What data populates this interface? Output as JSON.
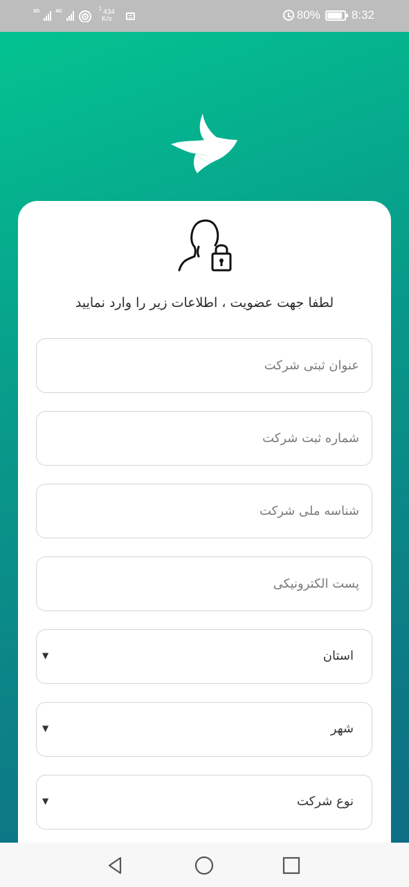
{
  "status_bar": {
    "net_type_1": "3G",
    "net_type_2": "4G",
    "speed_sup": "1",
    "speed_value": "434",
    "speed_unit": "K/s",
    "battery": "80%",
    "time": "8:32",
    "icons": [
      "signal-icon",
      "wifi-icon",
      "message-icon",
      "alarm-icon",
      "battery-icon"
    ]
  },
  "app": {
    "logo_icon": "bird-logo-icon",
    "form_icon": "user-lock-icon",
    "intro_text": "لطفا جهت عضویت ، اطلاعات زیر را وارد نمایید"
  },
  "form": {
    "fields": [
      {
        "placeholder": "عنوان ثبتی شرکت",
        "value": ""
      },
      {
        "placeholder": "شماره ثبت شرکت",
        "value": ""
      },
      {
        "placeholder": "شناسه ملی شرکت",
        "value": ""
      },
      {
        "placeholder": "پست الکترونیکی",
        "value": ""
      }
    ],
    "selects": [
      {
        "label": "استان",
        "caret": "▼"
      },
      {
        "label": "شهر",
        "caret": "▼"
      },
      {
        "label": "نوع شرکت",
        "caret": "▼"
      }
    ]
  },
  "nav": {
    "icons": [
      "back-triangle-icon",
      "home-circle-icon",
      "recents-square-icon"
    ]
  },
  "colors": {
    "gradient_start": "#03c391",
    "gradient_end": "#0e6d84",
    "status_bar": "#bdbdbd",
    "field_border": "#d4d4d4"
  }
}
